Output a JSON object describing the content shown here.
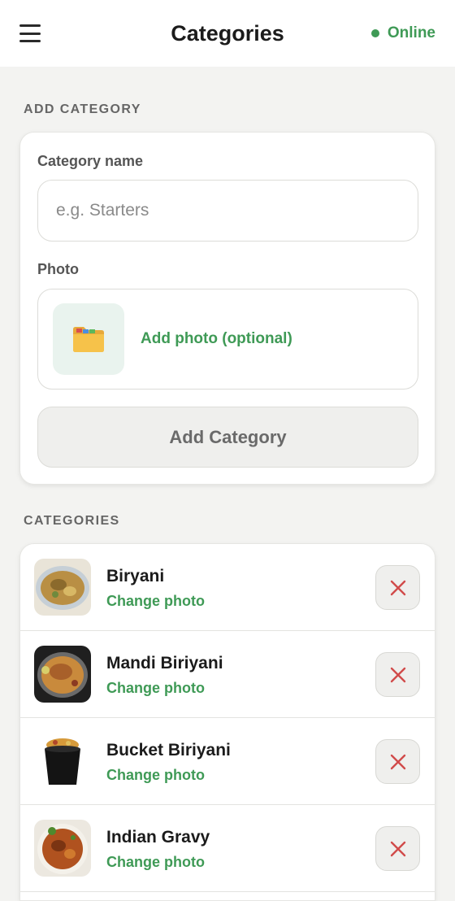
{
  "header": {
    "title": "Categories",
    "status": "Online",
    "status_color": "#3f9a56"
  },
  "add_section": {
    "label": "ADD CATEGORY",
    "name_label": "Category name",
    "name_placeholder": "e.g. Starters",
    "name_value": "",
    "photo_label": "Photo",
    "photo_icon": "folder-icon",
    "photo_text": "Add photo (optional)",
    "submit_label": "Add Category"
  },
  "list_section": {
    "label": "CATEGORIES",
    "items": [
      {
        "name": "Biryani",
        "action": "Change photo",
        "image": "biryani-photo"
      },
      {
        "name": "Mandi Biriyani",
        "action": "Change photo",
        "image": "mandi-biriyani-photo"
      },
      {
        "name": "Bucket Biriyani",
        "action": "Change photo",
        "image": "bucket-biriyani-photo"
      },
      {
        "name": "Indian Gravy",
        "action": "Change photo",
        "image": "indian-gravy-photo"
      }
    ]
  },
  "colors": {
    "accent": "#3f9a56",
    "delete": "#d14b4b",
    "background": "#f3f3f1"
  }
}
